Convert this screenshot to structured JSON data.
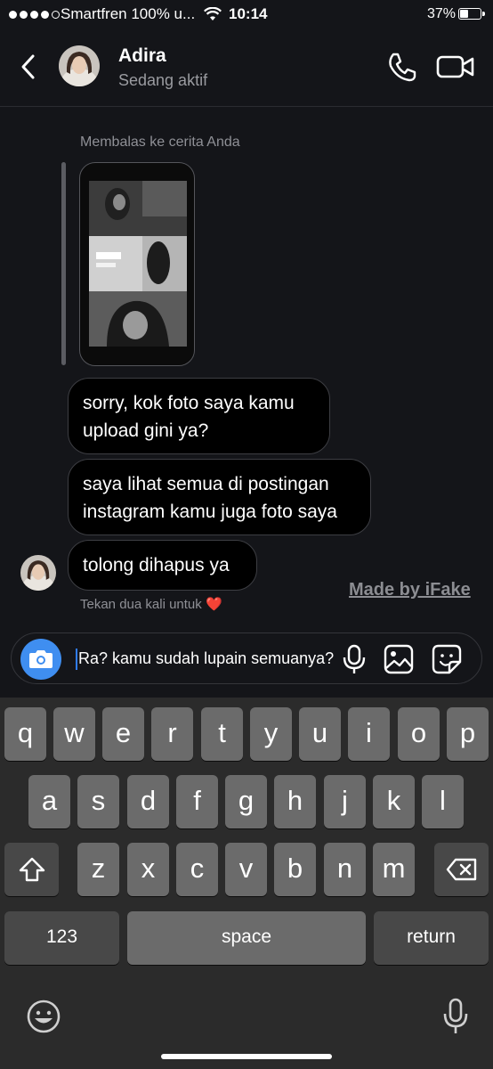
{
  "status_bar": {
    "carrier": "Smartfren 100% u...",
    "time": "10:14",
    "battery": "37%"
  },
  "header": {
    "name": "Adira",
    "status": "Sedang aktif"
  },
  "chat": {
    "reply_label": "Membalas ke cerita Anda",
    "messages": [
      {
        "text": "sorry, kok foto saya kamu upload gini ya?"
      },
      {
        "text": "saya lihat semua di postingan instagram kamu juga foto saya"
      },
      {
        "text": "tolong dihapus ya"
      }
    ],
    "like_hint": "Tekan dua kali untuk",
    "heart": "❤️",
    "watermark": "Made by iFake"
  },
  "composer": {
    "value": "Ra? kamu sudah lupain semuanya?"
  },
  "keyboard": {
    "row1": [
      "q",
      "w",
      "e",
      "r",
      "t",
      "y",
      "u",
      "i",
      "o",
      "p"
    ],
    "row2": [
      "a",
      "s",
      "d",
      "f",
      "g",
      "h",
      "j",
      "k",
      "l"
    ],
    "row3": [
      "z",
      "x",
      "c",
      "v",
      "b",
      "n",
      "m"
    ],
    "numbers_label": "123",
    "space_label": "space",
    "return_label": "return"
  },
  "icons": [
    "back-chevron-icon",
    "phone-icon",
    "video-icon",
    "camera-icon",
    "microphone-icon",
    "image-icon",
    "sticker-icon",
    "shift-icon",
    "backspace-icon",
    "emoji-icon",
    "dictation-icon"
  ]
}
